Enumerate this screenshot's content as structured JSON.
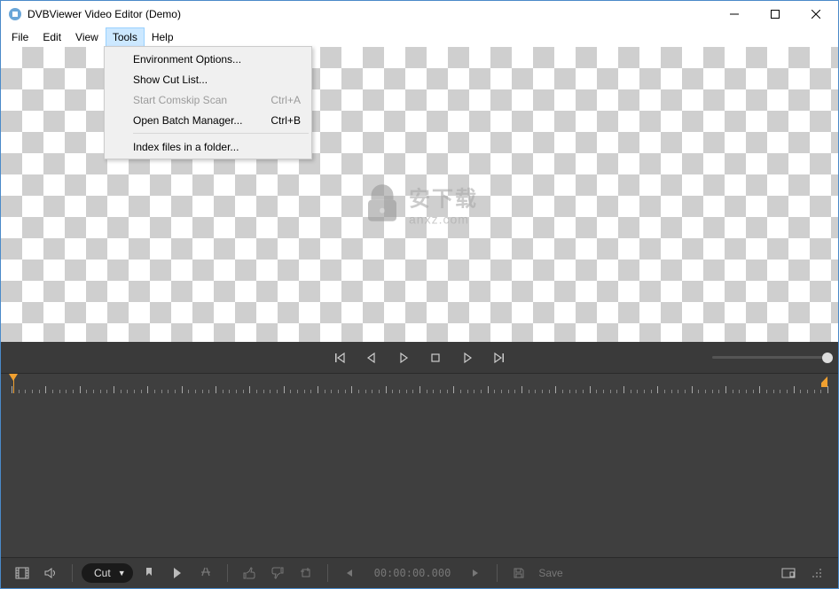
{
  "window": {
    "title": "DVBViewer Video Editor (Demo)"
  },
  "menubar": {
    "file": "File",
    "edit": "Edit",
    "view": "View",
    "tools": "Tools",
    "help": "Help"
  },
  "tools_menu": {
    "env_options": "Environment Options...",
    "show_cut_list": "Show Cut List...",
    "start_comskip": "Start Comskip Scan",
    "start_comskip_shortcut": "Ctrl+A",
    "open_batch": "Open Batch Manager...",
    "open_batch_shortcut": "Ctrl+B",
    "index_files": "Index files in a folder..."
  },
  "watermark": {
    "cn": "安下载",
    "en": "anxz.com"
  },
  "bottombar": {
    "cut_label": "Cut",
    "timecode": "00:00:00.000",
    "save_label": "Save"
  }
}
